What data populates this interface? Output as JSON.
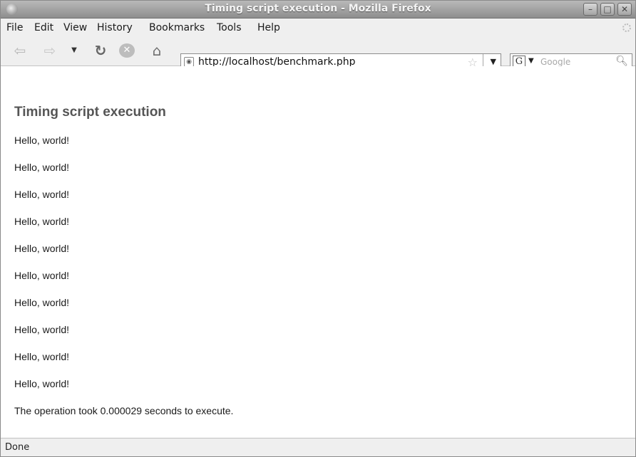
{
  "window": {
    "title": "Timing script execution - Mozilla Firefox"
  },
  "menu": [
    "File",
    "Edit",
    "View",
    "History",
    "Bookmarks",
    "Tools",
    "Help"
  ],
  "address": {
    "url": "http://localhost/benchmark.php"
  },
  "search": {
    "engine": "G",
    "placeholder": "Google"
  },
  "page": {
    "heading": "Timing script execution",
    "lines": [
      "Hello, world!",
      "Hello, world!",
      "Hello, world!",
      "Hello, world!",
      "Hello, world!",
      "Hello, world!",
      "Hello, world!",
      "Hello, world!",
      "Hello, world!",
      "Hello, world!"
    ],
    "result": "The operation took 0.000029 seconds to execute."
  },
  "status": "Done",
  "icons": {
    "back": "back-arrow-icon",
    "forward": "forward-arrow-icon",
    "history": "chevron-down-icon",
    "reload": "reload-icon",
    "stop": "stop-icon",
    "home": "home-icon",
    "bookmark": "star-icon",
    "search": "magnifier-icon"
  }
}
